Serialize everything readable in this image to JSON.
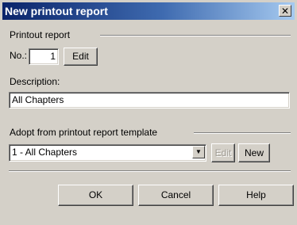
{
  "window": {
    "title": "New printout report",
    "close_glyph": "✕"
  },
  "printout_group": {
    "legend": "Printout report",
    "no_label": "No.:",
    "no_value": "1",
    "edit_label": "Edit"
  },
  "description": {
    "label": "Description:",
    "value": "All Chapters"
  },
  "template_group": {
    "legend": "Adopt from printout report template",
    "selected": "1 - All Chapters",
    "dropdown_glyph": "▼",
    "edit_label": "Edit",
    "new_label": "New"
  },
  "buttons": {
    "ok": "OK",
    "cancel": "Cancel",
    "help": "Help"
  }
}
